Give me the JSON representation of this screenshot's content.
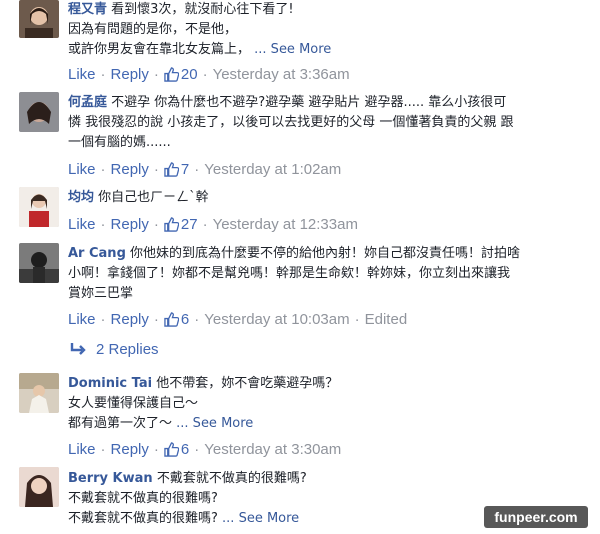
{
  "ui": {
    "like": "Like",
    "reply": "Reply",
    "sep": "·"
  },
  "comments": [
    {
      "author": "程又青",
      "lines": [
        "看到懷3次，就沒耐心往下看了!",
        "因為有問題的是你，不是他，",
        "或許你男友會在靠北女友篇上，"
      ],
      "see_more": "... See More",
      "likes": "20",
      "time": "Yesterday at 3:36am"
    },
    {
      "author": "何孟庭",
      "lines": [
        "不避孕 你為什麼也不避孕?避孕藥 避孕貼片 避孕器..... 靠么小孩很可",
        "憐 我很殘忍的說 小孩走了，以後可以去找更好的父母 一個懂著負責的父親 跟",
        "一個有腦的媽......"
      ],
      "likes": "7",
      "time": "Yesterday at 1:02am"
    },
    {
      "author": "均均",
      "lines": [
        "你自己也ㄏㄧㄥˋ幹"
      ],
      "likes": "27",
      "time": "Yesterday at 12:33am"
    },
    {
      "author": "Ar Cang",
      "lines": [
        "你他妹的到底為什麼要不停的給他內射！妳自己都沒責任嗎！討拍啥",
        "小啊！拿錢個了！妳都不是幫兇嗎！幹那是生命欸！幹妳妹，你立刻出來讓我",
        "賞妳三巴掌"
      ],
      "likes": "6",
      "time": "Yesterday at 10:03am",
      "edited": "Edited",
      "replies": "2 Replies"
    },
    {
      "author": "Dominic Tai",
      "lines": [
        "他不帶套，妳不會吃藥避孕嗎？",
        "女人要懂得保護自己～",
        "都有過第一次了～"
      ],
      "see_more": "... See More",
      "likes": "6",
      "time": "Yesterday at 3:30am"
    },
    {
      "author": "Berry Kwan",
      "lines": [
        "不戴套就不做真的很難嗎?",
        "不戴套就不做真的很難嗎?",
        "不戴套就不做真的很難嗎?"
      ],
      "see_more": "... See More"
    }
  ],
  "watermark": "funpeer.com"
}
